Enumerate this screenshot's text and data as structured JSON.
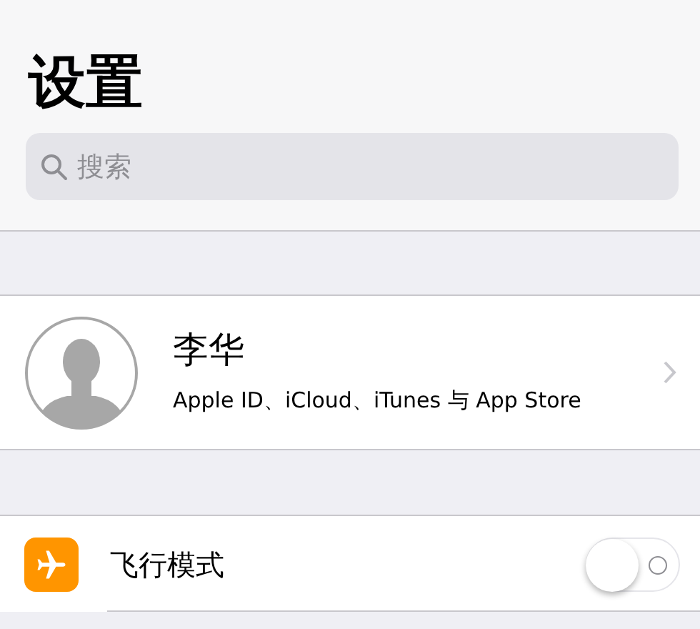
{
  "header": {
    "title": "设置",
    "search": {
      "placeholder": "搜索"
    }
  },
  "profile": {
    "name": "李华",
    "subtitle": "Apple ID、iCloud、iTunes 与 App Store"
  },
  "settings": [
    {
      "kind": "toggle",
      "label": "飞行模式",
      "on": false
    }
  ]
}
